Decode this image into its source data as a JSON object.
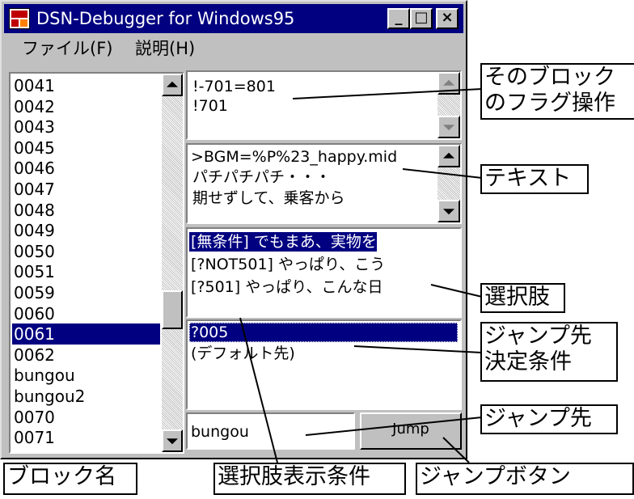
{
  "window": {
    "title": "DSN-Debugger for Windows95",
    "controls": {
      "minimize": "_",
      "maximize": "□",
      "close": "×"
    }
  },
  "menu": {
    "items": [
      "ファイル(F)",
      "説明(H)"
    ]
  },
  "block_list": {
    "items": [
      "0041",
      "0042",
      "0043",
      "0045",
      "0046",
      "0047",
      "0048",
      "0049",
      "0050",
      "0051",
      "0059",
      "0060",
      "0061",
      "0062",
      "bungou",
      "bungou2",
      "0070",
      "0071"
    ],
    "selected": "0061"
  },
  "flag_pane": {
    "lines": [
      "!-701=801",
      "!701"
    ]
  },
  "text_pane": {
    "lines": [
      ">BGM=%P%23_happy.mid",
      "  パチパチパチ・・・",
      "  期せずして、乗客から"
    ]
  },
  "choice_pane": {
    "lines": [
      "[無条件] でもまあ、実物を",
      "[?NOT501] やっぱり、こう",
      "[?501] やっぱり、こんな日"
    ],
    "selected_index": 0
  },
  "jump_pane": {
    "lines": [
      "?005",
      "(デフォルト先)"
    ],
    "selected_index": 0
  },
  "jump_input": {
    "value": "bungou"
  },
  "jump_button": {
    "label": "Jump"
  },
  "callouts": {
    "flag_ops": "そのブロック\nのフラグ操作",
    "text": "テキスト",
    "choices": "選択肢",
    "jump_condition": "ジャンプ先\n決定条件",
    "jump_target": "ジャンプ先",
    "block_name": "ブロック名",
    "choice_condition": "選択肢表示条件",
    "jump_button": "ジャンプボタン"
  }
}
